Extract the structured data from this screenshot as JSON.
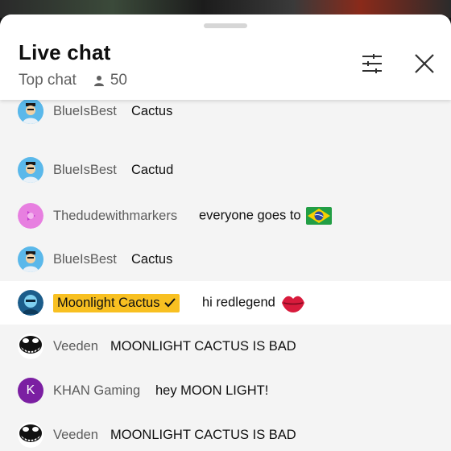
{
  "header": {
    "title": "Live chat",
    "mode_label": "Top chat",
    "viewer_count": "50"
  },
  "messages": [
    {
      "author": "BlueIsBest",
      "text": "Cactus",
      "avatar": "person-avatar-blue"
    },
    {
      "author": "BlueIsBest",
      "text": "Cactud",
      "avatar": "person-avatar-blue"
    },
    {
      "author": "Thedudewithmarkers",
      "text": "everyone goes to",
      "emoji": "brazil-flag",
      "avatar": "pink-avatar"
    },
    {
      "author": "BlueIsBest",
      "text": "Cactus",
      "avatar": "person-avatar-blue"
    },
    {
      "author": "Moonlight Cactus",
      "text": "hi redlegend",
      "emoji": "lips",
      "avatar": "moonlight-avatar",
      "verified": true
    },
    {
      "author": "Veeden",
      "text": "MOONLIGHT CACTUS IS BAD",
      "avatar": "grin-avatar"
    },
    {
      "author": "KHAN Gaming",
      "text": "hey MOON LIGHT!",
      "avatar": "letter-avatar",
      "avatar_letter": "K"
    },
    {
      "author": "Veeden",
      "text": "MOONLIGHT CACTUS IS BAD",
      "avatar": "grin-avatar"
    }
  ],
  "colors": {
    "member_badge": "#f8c021",
    "khan_avatar": "#7b1fa2",
    "blue_avatar": "#4fb3e8"
  }
}
